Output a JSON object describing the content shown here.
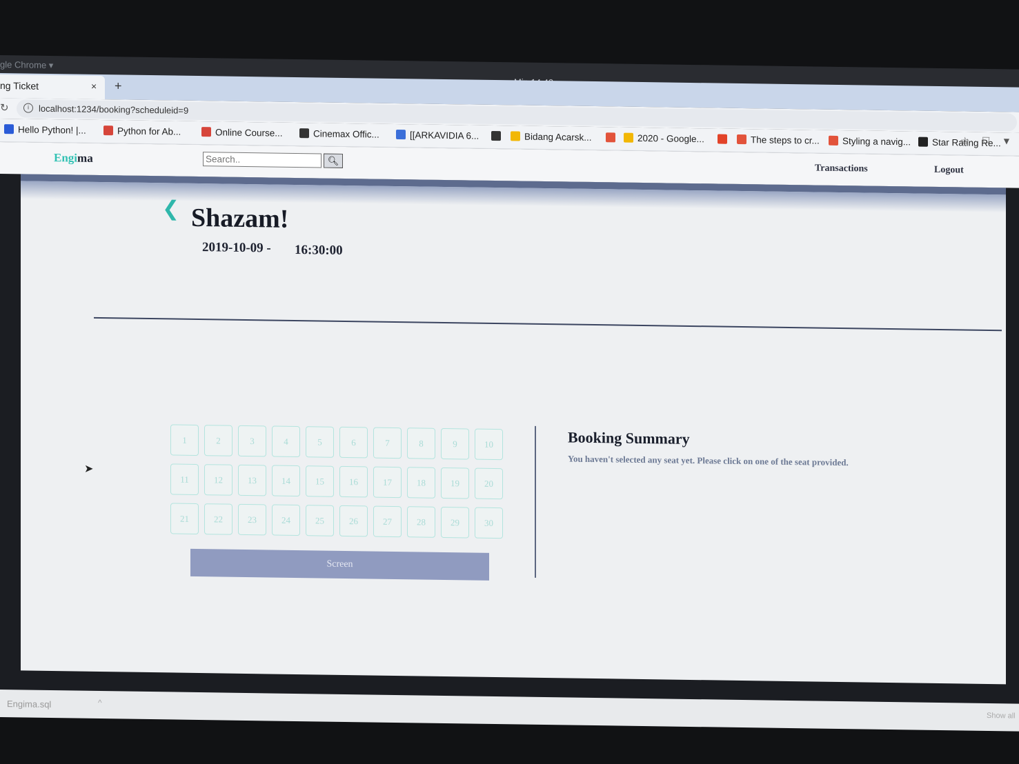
{
  "os": {
    "app_name": "gle Chrome ▾",
    "clock": "Min 14 42"
  },
  "browser": {
    "tab_title": "ng Ticket",
    "tab_close": "×",
    "new_tab": "+",
    "url": "localhost:1234/booking?scheduleid=9",
    "bookmarks": [
      {
        "label": "Hello Python! |...",
        "icon": "shield-bookmark-icon",
        "color": "#2a5bd7"
      },
      {
        "label": "Python for Ab...",
        "icon": "udemy-icon",
        "color": "#d6453a"
      },
      {
        "label": "Online Course...",
        "icon": "udemy-icon",
        "color": "#d6453a"
      },
      {
        "label": "Cinemax Offic...",
        "icon": "globe-icon",
        "color": "#333333"
      },
      {
        "label": "[[ARKAVIDIA 6...",
        "icon": "docs-icon",
        "color": "#3b6fd9"
      },
      {
        "label": "",
        "icon": "globe-icon",
        "color": "#333333"
      },
      {
        "label": "Bidang Acarsk...",
        "icon": "drive-icon",
        "color": "#f2b705"
      },
      {
        "label": "",
        "icon": "slides-icon",
        "color": "#e2533b"
      },
      {
        "label": "2020 - Google...",
        "icon": "drive-icon",
        "color": "#f2b705"
      },
      {
        "label": "",
        "icon": "gitlab-icon",
        "color": "#e24329"
      },
      {
        "label": "The steps to cr...",
        "icon": "slides-icon",
        "color": "#e2533b"
      },
      {
        "label": "Styling a navig...",
        "icon": "slides-icon",
        "color": "#e2533b"
      },
      {
        "label": "Star Rating Re...",
        "icon": "z-icon",
        "color": "#222222"
      }
    ]
  },
  "navbar": {
    "logo_accent": "Engi",
    "logo_rest": "ma",
    "search_placeholder": "Search..",
    "links": [
      "Transactions",
      "Logout"
    ]
  },
  "movie": {
    "back": "❮",
    "title": "Shazam!",
    "date": "2019-10-09 -",
    "time": "16:30:00"
  },
  "seats": [
    "1",
    "2",
    "3",
    "4",
    "5",
    "6",
    "7",
    "8",
    "9",
    "10",
    "11",
    "12",
    "13",
    "14",
    "15",
    "16",
    "17",
    "18",
    "19",
    "20",
    "21",
    "22",
    "23",
    "24",
    "25",
    "26",
    "27",
    "28",
    "29",
    "30"
  ],
  "screen_label": "Screen",
  "summary": {
    "title": "Booking Summary",
    "message": "You haven't selected any seat yet. Please click on one of the seat provided."
  },
  "downloads": {
    "file": "Engima.sql",
    "chevron": "^",
    "show_all": "Show all"
  },
  "colors": {
    "accent": "#33c2b4",
    "header_band": "#5d6b8e",
    "screen": "#909bc0"
  }
}
